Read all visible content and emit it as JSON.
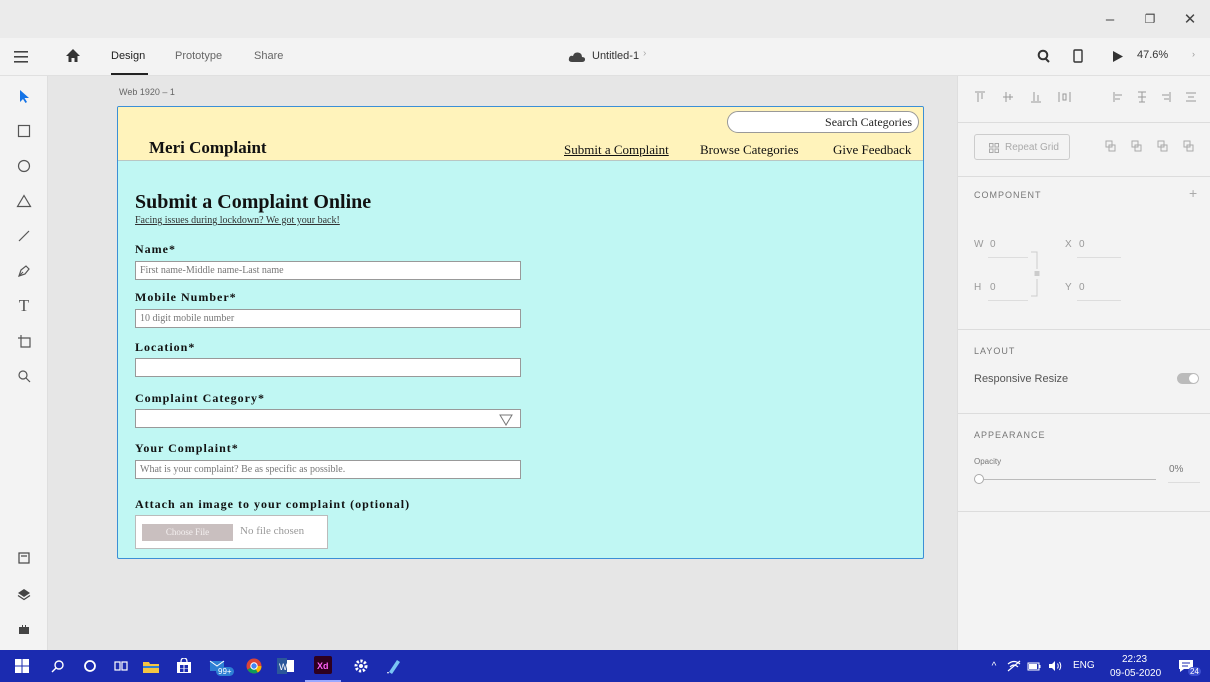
{
  "window": {
    "min_glyph": "–",
    "restore_glyph": "❐",
    "close_glyph": "✕"
  },
  "menu": {
    "tabs": [
      "Design",
      "Prototype",
      "Share"
    ],
    "active_tab": "Design",
    "doc_title": "Untitled-1",
    "zoom": "47.6%"
  },
  "canvas": {
    "artboard_label": "Web 1920 – 1"
  },
  "site": {
    "brand": "Meri Complaint",
    "search_placeholder": "Search Categories",
    "nav": [
      "Submit a Complaint",
      "Browse Categories",
      "Give Feedback"
    ]
  },
  "form": {
    "heading": "Submit a Complaint Online",
    "subheading": "Facing issues during lockdown? We got your back!",
    "name_label": "Name*",
    "name_placeholder": "First name-Middle name-Last name",
    "mobile_label": "Mobile Number*",
    "mobile_placeholder": "10 digit mobile number",
    "location_label": "Location*",
    "category_label": "Complaint Category*",
    "complaint_label": "Your Complaint*",
    "complaint_placeholder": "What is your complaint? Be as specific as possible.",
    "attach_label": "Attach an image to your complaint (optional)",
    "choose_file": "Choose File",
    "no_file": "No file chosen"
  },
  "panel": {
    "repeat_grid": "Repeat Grid",
    "component_title": "COMPONENT",
    "w_label": "W",
    "w_value": "0",
    "h_label": "H",
    "h_value": "0",
    "x_label": "X",
    "x_value": "0",
    "y_label": "Y",
    "y_value": "0",
    "layout_title": "LAYOUT",
    "responsive_resize": "Responsive Resize",
    "appearance_title": "APPEARANCE",
    "opacity_label": "Opacity",
    "opacity_value": "0%"
  },
  "taskbar": {
    "store_badge": "99+",
    "lang": "ENG",
    "time": "22:23",
    "date": "09-05-2020",
    "notif_count": "24"
  },
  "colors": {
    "accent": "#1473e6",
    "site_header": "#fff3bb",
    "form_bg": "#c0f7f3",
    "taskbar": "#1b2bb0"
  }
}
